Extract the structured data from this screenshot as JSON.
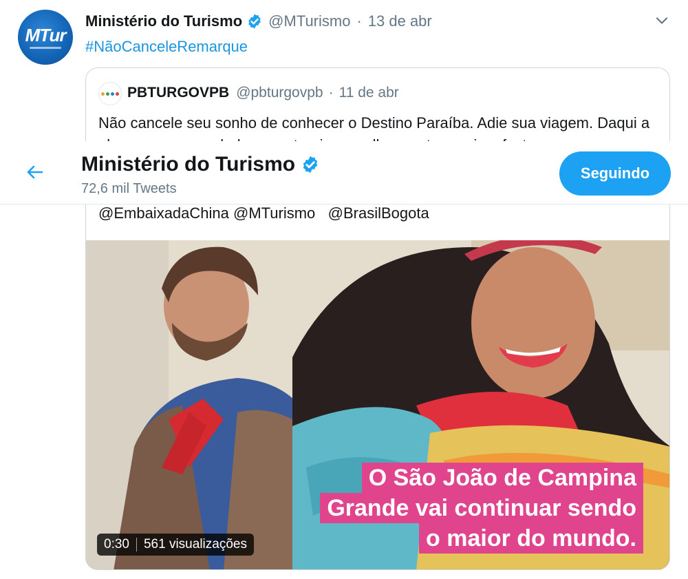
{
  "tweet": {
    "avatar_text": "MTur",
    "author_name": "Ministério do Turismo",
    "author_handle": "@MTurismo",
    "separator": "·",
    "date": "13 de abr",
    "hashtag": "#NãoCanceleRemarque"
  },
  "quoted": {
    "author_name": "PBTURGOVPB",
    "author_handle": "@pbturgovpb",
    "separator": "·",
    "date": "11 de abr",
    "text": "Não cancele seu sonho de conhecer o Destino Paraíba. Adie sua viagem. Daqui a alguns meses, as belezas naturais, a melhor gastronomia e festas",
    "mentions": "@EmbaixadaChina @MTurismo   @BrasilBogota",
    "media": {
      "caption_lines": [
        "O São João de Campina",
        "Grande vai continuar sendo",
        "o maior do mundo."
      ],
      "duration": "0:30",
      "views": "561 visualizações"
    }
  },
  "profile_header": {
    "name": "Ministério do Turismo",
    "tweet_count": "72,6 mil Tweets",
    "follow_label": "Seguindo"
  },
  "colors": {
    "accent": "#1da1f2",
    "link": "#1b95e0",
    "secondary_text": "#657786",
    "caption_bg": "#e0448c"
  },
  "icons": {
    "verified": "verified-badge-icon",
    "chevron": "chevron-down-icon",
    "back": "arrow-left-icon"
  }
}
